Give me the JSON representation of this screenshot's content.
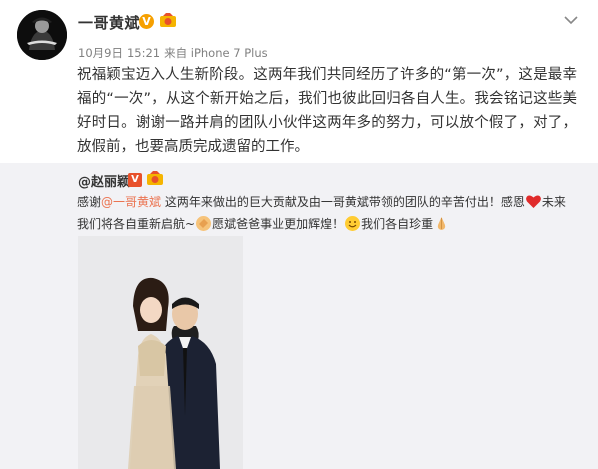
{
  "post": {
    "username": "一哥黄斌",
    "verified_badge": "V",
    "date": "10月9日",
    "time": "15:21",
    "source": "来自 iPhone 7 Plus",
    "text": "祝福颖宝迈入人生新阶段。这两年我们共同经历了许多的“第一次”，这是最幸福的“一次”，从这个新开始之后，我们也彼此回归各自人生。我会铭记这些美好时日。谢谢一路并肩的团队小伙伴这两年多的努力，可以放个假了，对了，放假前，也要高质完成遗留的工作。"
  },
  "repost": {
    "username": "@赵丽颖",
    "verified_badge": "V",
    "text_1": "感谢",
    "mention": "@一哥黄斌",
    "text_2": " 这两年来做出的巨大贡献及由一哥黄斌带领的团队的辛苦付出！感恩",
    "text_3": "未来我们将各自重新启航~",
    "text_4": "愿斌爸爸事业更加辉煌！",
    "text_5": "我们各自珍重"
  },
  "icons": {
    "menu": "chevron-down-icon",
    "medal": "medal-icon",
    "heart": "heart-icon",
    "smile": "smile-icon",
    "clap": "clap-icon"
  },
  "colors": {
    "link": "#eb7350",
    "repost_bg": "#f2f2f5",
    "verified_gold": "#f6a000"
  }
}
